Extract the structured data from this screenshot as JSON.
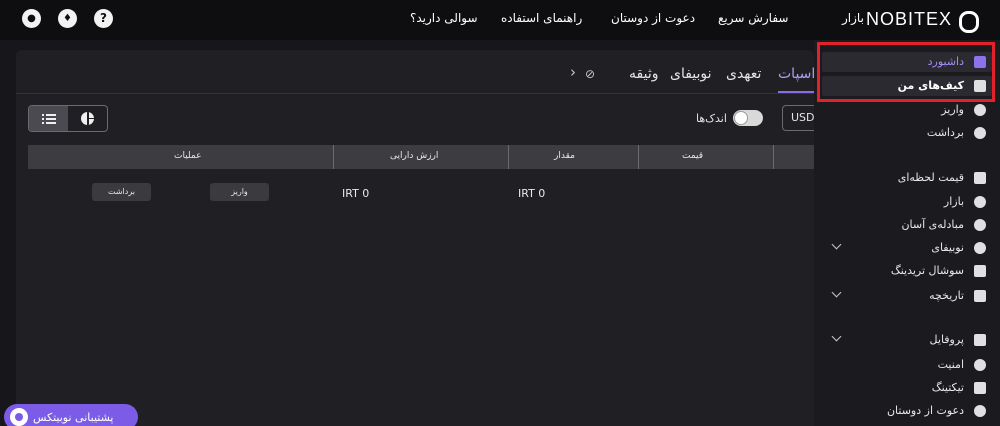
{
  "topbar": {
    "logo_text": "NOBITEX",
    "nav": [
      "بازار",
      "سفارش سریع",
      "دعوت از دوستان",
      "راهنمای استفاده",
      "سوالی دارید؟"
    ],
    "icons": [
      "user-icon",
      "bell-icon",
      "help-icon"
    ],
    "help_glyph": "?"
  },
  "tabs": [
    "اسپات",
    "تعهدی",
    "نوبیفای",
    "وثیقه"
  ],
  "tab_controls": {
    "hide_icon": "eye-off-icon",
    "next_glyph": "›"
  },
  "filters": {
    "small_balances_label": "اندک‌ها",
    "small_balances_on": false,
    "currency": "USDT",
    "view_modes": [
      "list-icon",
      "pie-chart-icon"
    ]
  },
  "table": {
    "columns": [
      "قیمت",
      "مقدار",
      "ارزش دارایی",
      "عملیات"
    ],
    "row": {
      "amount": "IRT 0",
      "value": "IRT 0",
      "deposit_label": "واریز",
      "withdraw_label": "برداشت"
    }
  },
  "support": {
    "label": "پشتیبانی نوبیتکس"
  },
  "sidebar": {
    "items": [
      {
        "label": "داشبورد",
        "icon": "dashboard-icon"
      },
      {
        "label": "کیف‌های من",
        "icon": "wallet-icon"
      },
      {
        "label": "واریز",
        "icon": "deposit-icon"
      },
      {
        "label": "برداشت",
        "icon": "withdraw-icon"
      },
      {
        "label": "قیمت لحظه‌ای",
        "icon": "price-chart-icon"
      },
      {
        "label": "بازار",
        "icon": "market-icon"
      },
      {
        "label": "مبادله‌ی آسان",
        "icon": "exchange-icon"
      },
      {
        "label": "نوبیفای",
        "icon": "nobify-icon"
      },
      {
        "label": "سوشال تریدینگ",
        "icon": "crown-icon"
      },
      {
        "label": "تاریخچه",
        "icon": "calendar-icon"
      },
      {
        "label": "پروفایل",
        "icon": "profile-icon"
      },
      {
        "label": "امنیت",
        "icon": "shield-icon"
      },
      {
        "label": "تیکتینگ",
        "icon": "ticket-icon"
      },
      {
        "label": "دعوت از دوستان",
        "icon": "invite-icon"
      }
    ]
  },
  "colors": {
    "accent": "#8b6be8",
    "highlight": "#e1222a",
    "background": "#17171b"
  }
}
